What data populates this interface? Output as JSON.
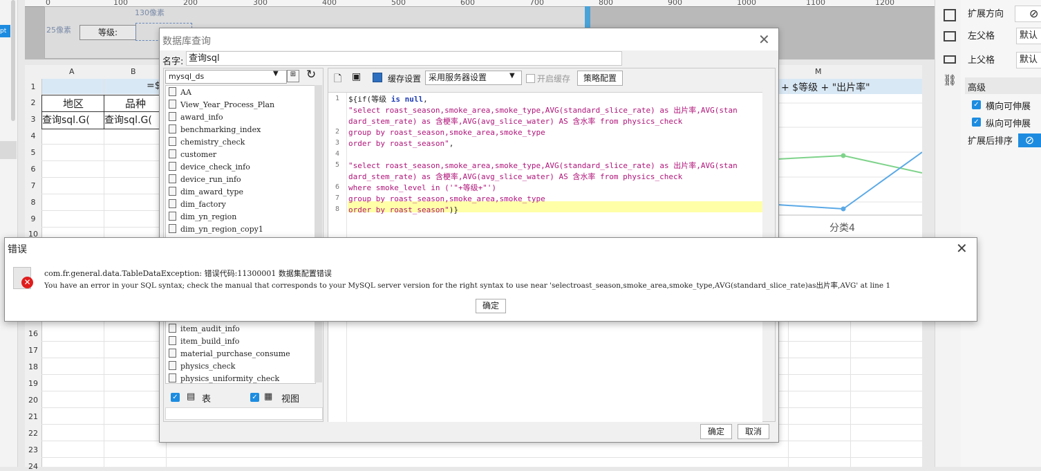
{
  "left_strip": {
    "tab_label": "pt"
  },
  "ruler": {
    "ticks": [
      "0",
      "100",
      "200",
      "300",
      "400",
      "500",
      "600",
      "700",
      "800",
      "900",
      "1000",
      "1100",
      "1200"
    ]
  },
  "param_panel": {
    "dim_130": "130像素",
    "dim_25": "25像素",
    "level_label": "等级:"
  },
  "sheet": {
    "columns": [
      "A",
      "B",
      "M"
    ],
    "rows": [
      "1",
      "2",
      "3",
      "4",
      "5",
      "6",
      "7",
      "8",
      "9",
      "10",
      "16",
      "17",
      "18",
      "19",
      "20",
      "21",
      "22",
      "23",
      "24"
    ],
    "header_row": {
      "region": "地区",
      "variety": "品种"
    },
    "data_row": {
      "a3": "查询sql.G(",
      "b3": "查询sql.G("
    },
    "title_fragment": "=$",
    "formula_fragment": "+ $等级 + \"出片率\"",
    "chart_category": "分类4"
  },
  "right_panel": {
    "expand_direction_label": "扩展方向",
    "left_parent_label": "左父格",
    "left_parent_value": "默认",
    "top_parent_label": "上父格",
    "top_parent_value": "默认",
    "advanced_label": "高级",
    "horizontal_expand_label": "横向可伸展",
    "vertical_expand_label": "纵向可伸展",
    "sort_after_expand_label": "扩展后排序"
  },
  "db_dialog": {
    "title": "数据库查询",
    "name_label": "名字:",
    "name_value": "查询sql",
    "datasource": "mysql_ds",
    "tables": [
      "AA",
      "View_Year_Process_Plan",
      "award_info",
      "benchmarking_index",
      "chemistry_check",
      "customer",
      "device_check_info",
      "device_run_info",
      "dim_award_type",
      "dim_factory",
      "dim_yn_region",
      "dim_yn_region_copy1"
    ],
    "tables_lower": [
      "item_audit_info",
      "item_build_info",
      "material_purchase_consume",
      "physics_check",
      "physics_uniformity_check"
    ],
    "filter_table_label": "表",
    "filter_view_label": "视图",
    "cache_settings_label": "缓存设置",
    "cache_select_value": "采用服务器设置",
    "enable_cache_label": "开启缓存",
    "strategy_button": "策略配置",
    "code_lines": [
      {
        "num": "1",
        "parts": [
          [
            "plain",
            "${if("
          ],
          [
            "plain",
            "等级 "
          ],
          [
            "kw",
            "is null"
          ],
          [
            "plain",
            ","
          ]
        ]
      },
      {
        "num": "",
        "parts": [
          [
            "str",
            "\"select roast_season,smoke_area,smoke_type,AVG(standard_slice_rate) as 出片率,AVG(stan"
          ]
        ]
      },
      {
        "num": "",
        "parts": [
          [
            "str",
            "dard_stem_rate) as 含梗率,AVG(avg_slice_water) AS 含水率 from physics_check"
          ]
        ]
      },
      {
        "num": "2",
        "parts": [
          [
            "str",
            "group by  roast_season,smoke_area,smoke_type"
          ]
        ]
      },
      {
        "num": "3",
        "parts": [
          [
            "str",
            "order by roast_season\""
          ],
          [
            "plain",
            ","
          ]
        ]
      },
      {
        "num": "4",
        "parts": [
          [
            "plain",
            ""
          ]
        ]
      },
      {
        "num": "5",
        "parts": [
          [
            "str",
            "\"select roast_season,smoke_area,smoke_type,AVG(standard_slice_rate) as 出片率,AVG(stan"
          ]
        ]
      },
      {
        "num": "",
        "parts": [
          [
            "str",
            "dard_stem_rate) as 含梗率,AVG(avg_slice_water) AS 含水率 from physics_check"
          ]
        ]
      },
      {
        "num": "6",
        "parts": [
          [
            "str",
            "where smoke_level in ('\"+等级+\"')"
          ]
        ]
      },
      {
        "num": "7",
        "parts": [
          [
            "str",
            "group by  roast_season,smoke_area,smoke_type"
          ]
        ]
      },
      {
        "num": "8",
        "parts": [
          [
            "str",
            "order by roast_season\""
          ],
          [
            "plain",
            ")}"
          ]
        ]
      }
    ],
    "ok_button": "确定",
    "cancel_button": "取消"
  },
  "error_dialog": {
    "title": "错误",
    "line1": "com.fr.general.data.TableDataException: 错误代码:11300001 数据集配置错误",
    "line2": "You have an error in your SQL syntax; check the manual that corresponds to your MySQL server version for the right syntax to use near 'selectroast_season,smoke_area,smoke_type,AVG(standard_slice_rate)as出片率,AVG' at line 1",
    "ok_button": "确定"
  },
  "colors": {
    "accent": "#1d8ce0",
    "error": "#e01d1d",
    "highlight": "#ffffa8",
    "row1_band": "#d9e8f5"
  }
}
